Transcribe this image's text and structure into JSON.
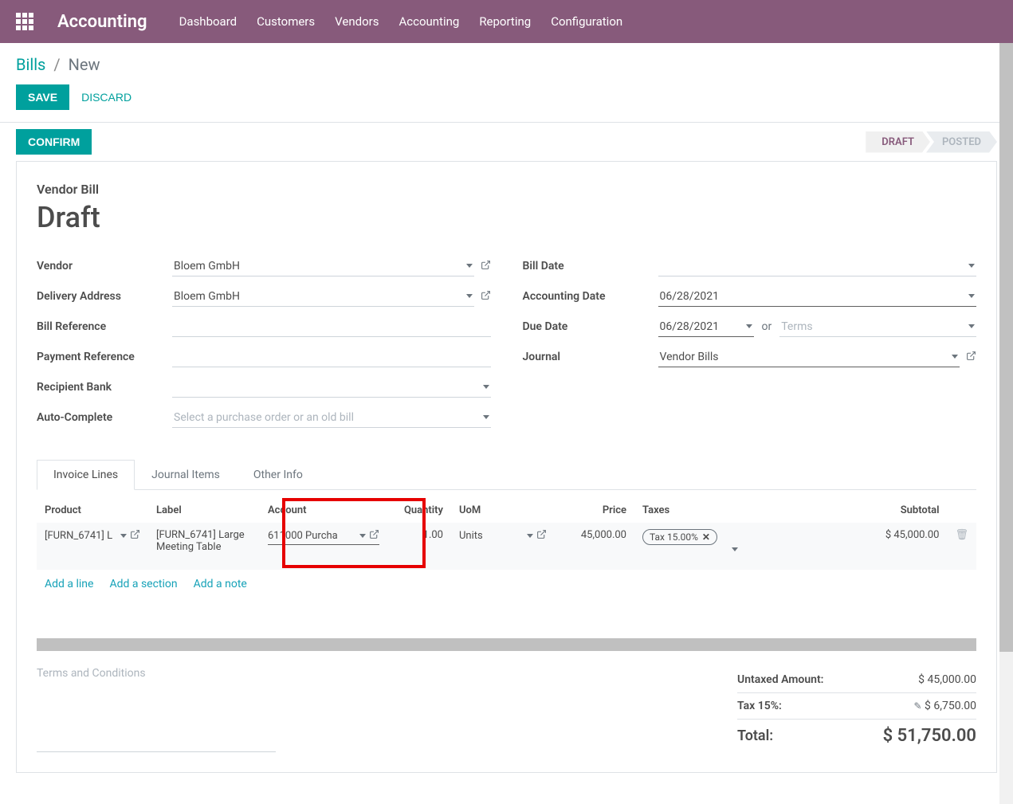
{
  "header": {
    "app_title": "Accounting",
    "menu": [
      "Dashboard",
      "Customers",
      "Vendors",
      "Accounting",
      "Reporting",
      "Configuration"
    ]
  },
  "breadcrumb": {
    "parent": "Bills",
    "current": "New"
  },
  "actions": {
    "save": "SAVE",
    "discard": "DISCARD",
    "confirm": "CONFIRM"
  },
  "status_steps": [
    {
      "label": "DRAFT",
      "active": true
    },
    {
      "label": "POSTED",
      "active": false
    }
  ],
  "form": {
    "title_small": "Vendor Bill",
    "title_big": "Draft",
    "left": {
      "vendor_label": "Vendor",
      "vendor_value": "Bloem GmbH",
      "delivery_label": "Delivery Address",
      "delivery_value": "Bloem GmbH",
      "billref_label": "Bill Reference",
      "billref_value": "",
      "payref_label": "Payment Reference",
      "payref_value": "",
      "bank_label": "Recipient Bank",
      "bank_value": "",
      "auto_label": "Auto-Complete",
      "auto_placeholder": "Select a purchase order or an old bill"
    },
    "right": {
      "billdate_label": "Bill Date",
      "billdate_value": "",
      "accdate_label": "Accounting Date",
      "accdate_value": "06/28/2021",
      "duedate_label": "Due Date",
      "duedate_value": "06/28/2021",
      "or_label": "or",
      "terms_placeholder": "Terms",
      "journal_label": "Journal",
      "journal_value": "Vendor Bills"
    }
  },
  "tabs": [
    "Invoice Lines",
    "Journal Items",
    "Other Info"
  ],
  "lines": {
    "headers": {
      "product": "Product",
      "label": "Label",
      "account": "Account",
      "quantity": "Quantity",
      "uom": "UoM",
      "price": "Price",
      "taxes": "Taxes",
      "subtotal": "Subtotal"
    },
    "rows": [
      {
        "product": "[FURN_6741] L",
        "label": "[FURN_6741] Large Meeting Table",
        "account": "611000 Purcha",
        "quantity": "1.00",
        "uom": "Units",
        "price": "45,000.00",
        "tax": "Tax 15.00%",
        "subtotal": "$ 45,000.00"
      }
    ],
    "add_line": "Add a line",
    "add_section": "Add a section",
    "add_note": "Add a note"
  },
  "terms_placeholder": "Terms and Conditions",
  "totals": {
    "untaxed_label": "Untaxed Amount:",
    "untaxed_val": "$ 45,000.00",
    "tax_label": "Tax 15%:",
    "tax_val": "$ 6,750.00",
    "total_label": "Total:",
    "total_val": "$ 51,750.00"
  }
}
